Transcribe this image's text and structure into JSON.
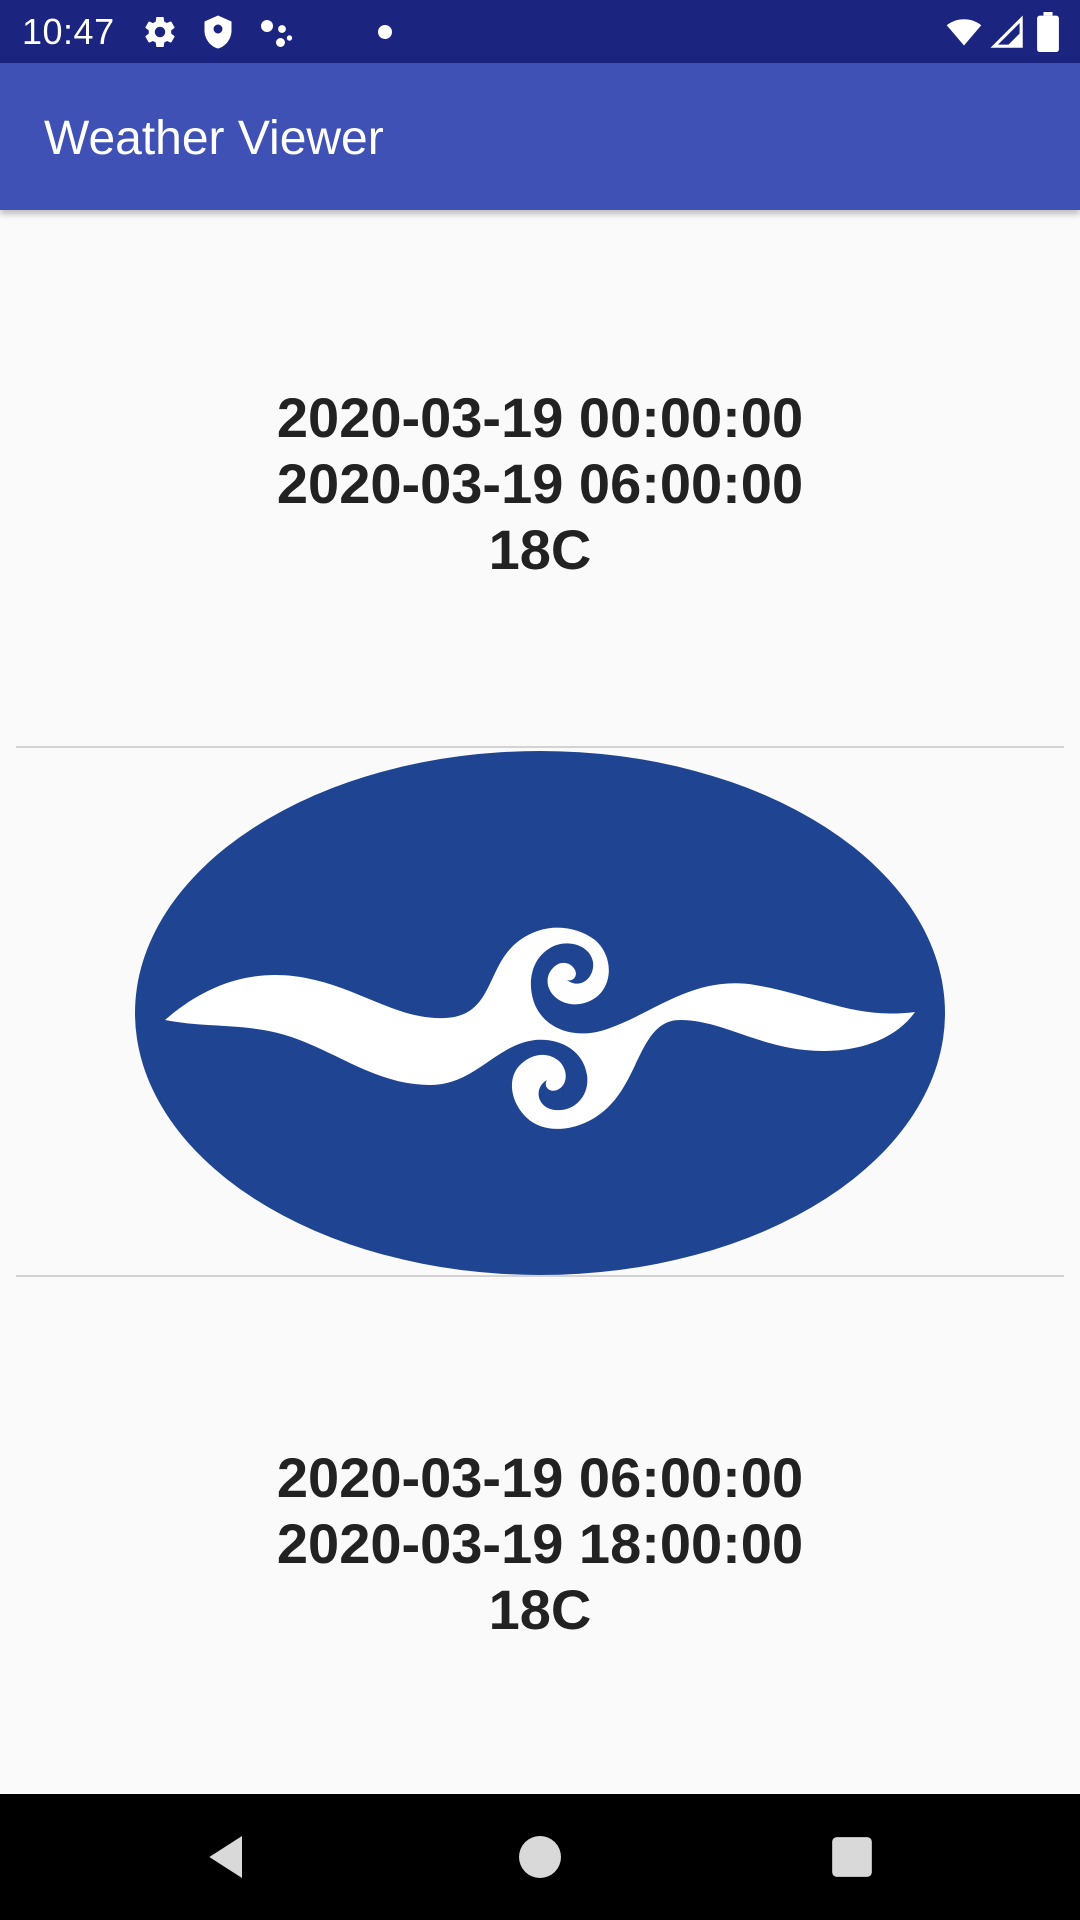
{
  "status_bar": {
    "time": "10:47",
    "icons": [
      "gear-icon",
      "shield-icon",
      "assistant-dots-icon",
      "notification-dot-icon",
      "wifi-icon",
      "cell-signal-icon",
      "battery-icon"
    ]
  },
  "app_bar": {
    "title": "Weather Viewer"
  },
  "forecasts": [
    {
      "start": "2020-03-19 00:00:00",
      "end": "2020-03-19 06:00:00",
      "temperature": "18C"
    },
    {
      "start": "2020-03-19 06:00:00",
      "end": "2020-03-19 18:00:00",
      "temperature": "18C"
    }
  ],
  "logo": {
    "icon": "wind-emblem-icon",
    "color": "#1f4592"
  },
  "nav_bar": {
    "icons": [
      "back-icon",
      "home-icon",
      "recents-icon"
    ]
  },
  "colors": {
    "status_bar": "#1b2580",
    "app_bar": "#3f51b5",
    "background": "#fafafa"
  }
}
